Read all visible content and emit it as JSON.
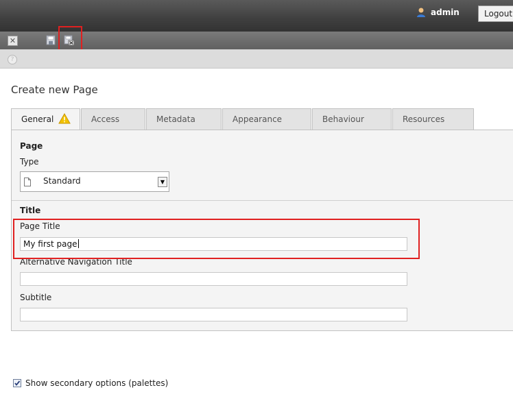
{
  "header": {
    "username": "admin",
    "logout_label": "Logout"
  },
  "toolbar": {
    "close_icon": "close-icon",
    "save_icon": "save-icon",
    "save_close_icon": "save-and-close-icon"
  },
  "docheader": {
    "help_icon": "help-icon"
  },
  "page": {
    "heading": "Create new Page"
  },
  "tabs": [
    {
      "label": "General",
      "active": true,
      "warning": true
    },
    {
      "label": "Access"
    },
    {
      "label": "Metadata"
    },
    {
      "label": "Appearance"
    },
    {
      "label": "Behaviour"
    },
    {
      "label": "Resources"
    }
  ],
  "form": {
    "page_section": "Page",
    "type_label": "Type",
    "type_value": "Standard",
    "title_section": "Title",
    "page_title_label": "Page Title",
    "page_title_value": "My first page",
    "nav_title_label": "Alternative Navigation Title",
    "nav_title_value": "",
    "subtitle_label": "Subtitle",
    "subtitle_value": ""
  },
  "footer": {
    "palettes_label": "Show secondary options (palettes)",
    "palettes_checked": true
  },
  "colors": {
    "highlight": "#e02020",
    "topbar": "#3f3f3f",
    "warning": "#f2c200"
  }
}
